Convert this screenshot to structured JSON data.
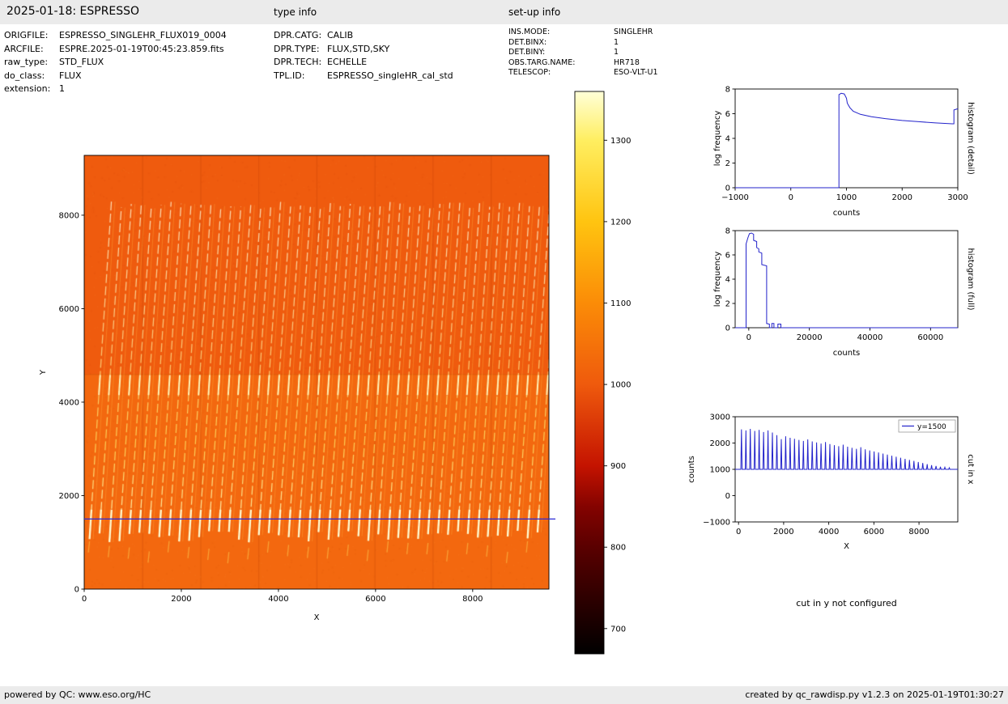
{
  "header": {
    "title": "2025-01-18: ESPRESSO",
    "type_info_heading": "type info",
    "setup_info_heading": "set-up info"
  },
  "file_info": {
    "rows": [
      {
        "label": "ORIGFILE:",
        "value": "ESPRESSO_SINGLEHR_FLUX019_0004"
      },
      {
        "label": "ARCFILE:",
        "value": "ESPRE.2025-01-19T00:45:23.859.fits"
      },
      {
        "label": "raw_type:",
        "value": "STD_FLUX"
      },
      {
        "label": "do_class:",
        "value": "FLUX"
      },
      {
        "label": "extension:",
        "value": "1"
      }
    ]
  },
  "type_info": {
    "rows": [
      {
        "label": "DPR.CATG:",
        "value": "CALIB"
      },
      {
        "label": "DPR.TYPE:",
        "value": "FLUX,STD,SKY"
      },
      {
        "label": "DPR.TECH:",
        "value": "ECHELLE"
      },
      {
        "label": "TPL.ID:",
        "value": "ESPRESSO_singleHR_cal_std"
      }
    ]
  },
  "setup_info": {
    "rows": [
      {
        "label": "INS.MODE:",
        "value": "SINGLEHR"
      },
      {
        "label": "DET.BINX:",
        "value": "1"
      },
      {
        "label": "DET.BINY:",
        "value": "1"
      },
      {
        "label": "OBS.TARG.NAME:",
        "value": "HR718"
      },
      {
        "label": "TELESCOP:",
        "value": "ESO-VLT-U1"
      }
    ]
  },
  "notes": {
    "cut_in_y": "cut in y not configured"
  },
  "footer": {
    "left": "powered by QC: www.eso.org/HC",
    "right": "created by qc_rawdisp.py v1.2.3 on 2025-01-19T01:30:27"
  },
  "chart_data": [
    {
      "id": "raw_image",
      "type": "heatmap",
      "xlabel": "X",
      "ylabel": "Y",
      "xlim": [
        0,
        9570
      ],
      "ylim": [
        0,
        9280
      ],
      "xticks": [
        0,
        2000,
        4000,
        6000,
        8000
      ],
      "yticks": [
        0,
        2000,
        4000,
        6000,
        8000
      ],
      "background_counts": 1000,
      "background_color": "#ef5b0e",
      "lower_region_color": "#f3680f",
      "boundary_y": 4600,
      "amp_band_width": 1196,
      "streak_count": 46,
      "streak_x_start": 110,
      "order_spacing_x": 205,
      "streak_y_range": [
        1000,
        8300
      ],
      "streak_tilt_x": 450,
      "cut_line": {
        "y": 1500,
        "color": "#2b2bd6"
      },
      "description": "Raw ESPRESSO echelle exposure: about 46 slightly tilted bright order streaks (white/yellow) between y~1000 and y~8300 on a uniform orange background at ~1000 counts; brighter dashes near the order bottoms (y~1000-1700) and just below the detector boundary at y~4600; faint amplifier bands every ~1196 px in x; horizontal blue cut line at y=1500."
    },
    {
      "id": "colorbar",
      "type": "colorbar",
      "ticks": [
        700,
        800,
        900,
        1000,
        1100,
        1200,
        1300
      ],
      "range": [
        669,
        1360
      ],
      "stops": [
        {
          "value": 669,
          "color": "#000000"
        },
        {
          "value": 740,
          "color": "#300000"
        },
        {
          "value": 800,
          "color": "#5a0000"
        },
        {
          "value": 850,
          "color": "#840300"
        },
        {
          "value": 900,
          "color": "#c41300"
        },
        {
          "value": 1000,
          "color": "#ef5a0d"
        },
        {
          "value": 1100,
          "color": "#fb8c07"
        },
        {
          "value": 1200,
          "color": "#ffc410"
        },
        {
          "value": 1300,
          "color": "#ffee60"
        },
        {
          "value": 1360,
          "color": "#ffffd8"
        }
      ]
    },
    {
      "id": "histogram_detail",
      "type": "line",
      "xlabel": "counts",
      "ylabel": "log frequency",
      "right_label": "histogram (detail)",
      "xlim": [
        -1000,
        3000
      ],
      "ylim": [
        0,
        8
      ],
      "xticks": [
        -1000,
        0,
        1000,
        2000,
        3000
      ],
      "yticks": [
        0,
        2,
        4,
        6,
        8
      ],
      "line_color": "#2323cb",
      "points": [
        [
          -1000,
          0
        ],
        [
          865,
          0
        ],
        [
          865,
          7.55
        ],
        [
          905,
          7.65
        ],
        [
          960,
          7.6
        ],
        [
          1000,
          7.25
        ],
        [
          1015,
          6.85
        ],
        [
          1060,
          6.5
        ],
        [
          1120,
          6.2
        ],
        [
          1250,
          5.95
        ],
        [
          1450,
          5.75
        ],
        [
          1700,
          5.6
        ],
        [
          2000,
          5.45
        ],
        [
          2300,
          5.35
        ],
        [
          2600,
          5.25
        ],
        [
          2900,
          5.18
        ],
        [
          2930,
          5.18
        ],
        [
          2930,
          6.3
        ],
        [
          3000,
          6.4
        ]
      ]
    },
    {
      "id": "histogram_full",
      "type": "line",
      "xlabel": "counts",
      "ylabel": "log frequency",
      "right_label": "histogram (full)",
      "xlim": [
        -4500,
        69000
      ],
      "ylim": [
        0,
        8
      ],
      "xticks": [
        0,
        20000,
        40000,
        60000
      ],
      "yticks": [
        0,
        2,
        4,
        6,
        8
      ],
      "line_color": "#2323cb",
      "points": [
        [
          -4500,
          0
        ],
        [
          -900,
          0
        ],
        [
          -900,
          6.9
        ],
        [
          -300,
          7.4
        ],
        [
          200,
          7.75
        ],
        [
          900,
          7.8
        ],
        [
          1600,
          7.7
        ],
        [
          1600,
          7.2
        ],
        [
          2600,
          7.1
        ],
        [
          2600,
          6.6
        ],
        [
          3300,
          6.5
        ],
        [
          3300,
          6.25
        ],
        [
          4300,
          6.15
        ],
        [
          4300,
          5.2
        ],
        [
          5900,
          5.1
        ],
        [
          5900,
          0.35
        ],
        [
          6800,
          0.3
        ],
        [
          6800,
          0
        ],
        [
          7600,
          0
        ],
        [
          7600,
          0.35
        ],
        [
          8300,
          0.35
        ],
        [
          8300,
          0
        ],
        [
          9600,
          0
        ],
        [
          9600,
          0.3
        ],
        [
          10600,
          0.3
        ],
        [
          10600,
          0
        ],
        [
          69000,
          0
        ]
      ]
    },
    {
      "id": "cut_in_x",
      "type": "line",
      "xlabel": "X",
      "ylabel": "counts",
      "right_label": "cut in x",
      "legend": [
        "y=1500"
      ],
      "xlim": [
        -150,
        9720
      ],
      "ylim": [
        -1000,
        3000
      ],
      "xticks": [
        0,
        2000,
        4000,
        6000,
        8000
      ],
      "yticks": [
        -1000,
        0,
        1000,
        2000,
        3000
      ],
      "line_color": "#2323cb",
      "baseline": 1000,
      "spike_half_width": 28,
      "spikes": [
        [
          130,
          2520
        ],
        [
          326,
          2480
        ],
        [
          522,
          2540
        ],
        [
          718,
          2460
        ],
        [
          914,
          2500
        ],
        [
          1110,
          2420
        ],
        [
          1306,
          2480
        ],
        [
          1502,
          2400
        ],
        [
          1698,
          2300
        ],
        [
          1894,
          2150
        ],
        [
          2090,
          2260
        ],
        [
          2286,
          2200
        ],
        [
          2482,
          2160
        ],
        [
          2678,
          2120
        ],
        [
          2874,
          2080
        ],
        [
          3070,
          2140
        ],
        [
          3266,
          2060
        ],
        [
          3462,
          2020
        ],
        [
          3658,
          1980
        ],
        [
          3854,
          2040
        ],
        [
          4050,
          1960
        ],
        [
          4246,
          1920
        ],
        [
          4442,
          1880
        ],
        [
          4638,
          1940
        ],
        [
          4834,
          1860
        ],
        [
          5030,
          1820
        ],
        [
          5226,
          1780
        ],
        [
          5422,
          1840
        ],
        [
          5618,
          1760
        ],
        [
          5814,
          1720
        ],
        [
          6010,
          1680
        ],
        [
          6206,
          1640
        ],
        [
          6402,
          1600
        ],
        [
          6598,
          1560
        ],
        [
          6794,
          1520
        ],
        [
          6990,
          1480
        ],
        [
          7186,
          1440
        ],
        [
          7382,
          1400
        ],
        [
          7578,
          1360
        ],
        [
          7774,
          1320
        ],
        [
          7970,
          1280
        ],
        [
          8166,
          1240
        ],
        [
          8362,
          1200
        ],
        [
          8558,
          1160
        ],
        [
          8754,
          1130
        ],
        [
          8950,
          1100
        ],
        [
          9146,
          1080
        ],
        [
          9342,
          1060
        ]
      ]
    }
  ]
}
